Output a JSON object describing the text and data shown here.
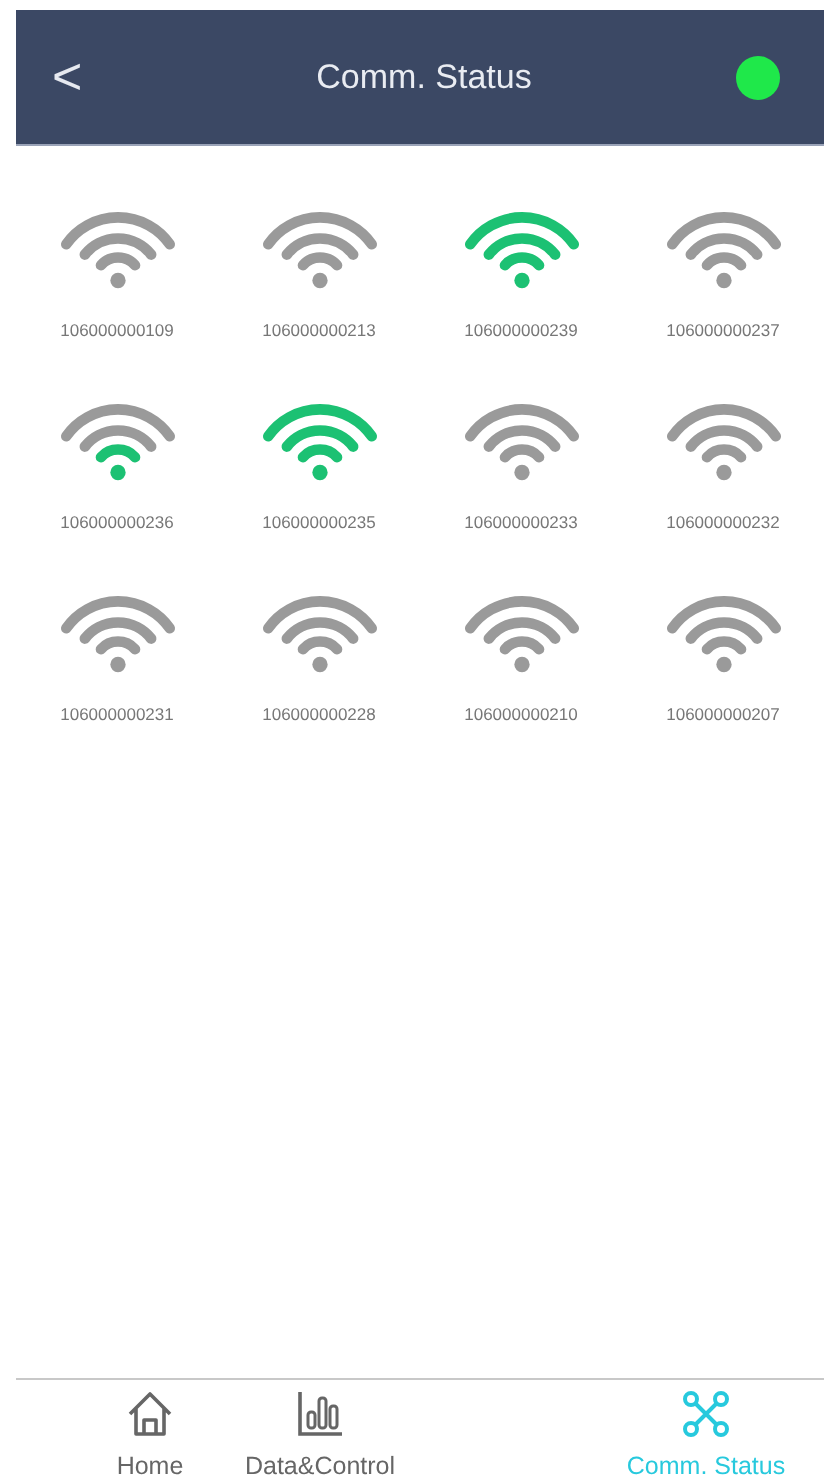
{
  "header": {
    "back": "<",
    "title": "Comm. Status",
    "connected": true
  },
  "devices": [
    {
      "id": "106000000109",
      "kind": "none"
    },
    {
      "id": "106000000213",
      "kind": "none"
    },
    {
      "id": "106000000239",
      "kind": "strong"
    },
    {
      "id": "106000000237",
      "kind": "none"
    },
    {
      "id": "106000000236",
      "kind": "weak"
    },
    {
      "id": "106000000235",
      "kind": "strong"
    },
    {
      "id": "106000000233",
      "kind": "none"
    },
    {
      "id": "106000000232",
      "kind": "none"
    },
    {
      "id": "106000000231",
      "kind": "none"
    },
    {
      "id": "106000000228",
      "kind": "none"
    },
    {
      "id": "106000000210",
      "kind": "none"
    },
    {
      "id": "106000000207",
      "kind": "none"
    }
  ],
  "tabs": [
    {
      "kind": "home",
      "label": "Home",
      "selected": false
    },
    {
      "kind": "chart",
      "label": "Data&Control",
      "selected": false
    },
    {
      "kind": "network",
      "label": "Comm. Status",
      "selected": true
    }
  ]
}
